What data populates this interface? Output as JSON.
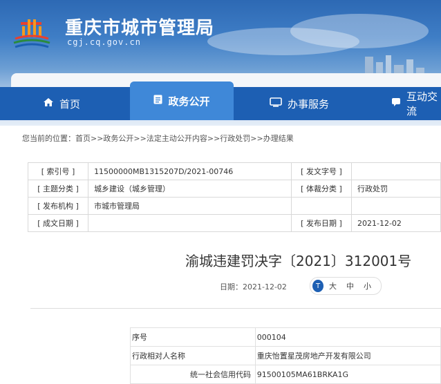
{
  "header": {
    "site_title": "重庆市城市管理局",
    "site_url": "cgj.cq.gov.cn",
    "logo": "chongqing-city-management-logo"
  },
  "nav": {
    "items": [
      {
        "label": "首页",
        "icon": "home-icon"
      },
      {
        "label": "政务公开",
        "icon": "document-icon",
        "active": true
      },
      {
        "label": "办事服务",
        "icon": "service-icon"
      },
      {
        "label": "互动交流",
        "icon": "chat-icon"
      }
    ]
  },
  "breadcrumb": {
    "prefix": "您当前的位置：",
    "path": "首页>>政务公开>>法定主动公开内容>>行政处罚>>办理结果"
  },
  "meta": {
    "index_label": "[ 索引号 ]",
    "index_value": "11500000MB1315207D/2021-00746",
    "doc_no_label": "[ 发文字号 ]",
    "doc_no_value": "",
    "topic_label": "[ 主题分类 ]",
    "topic_value": "城乡建设（城乡管理）",
    "genre_label": "[ 体裁分类 ]",
    "genre_value": "行政处罚",
    "org_label": "[ 发布机构 ]",
    "org_value": "市城市管理局",
    "created_label": "[ 成文日期 ]",
    "created_value": "",
    "published_label": "[ 发布日期 ]",
    "published_value": "2021-12-02"
  },
  "article": {
    "title": "渝城违建罚决字〔2021〕312001号",
    "date": "日期：2021-12-02",
    "font_icon_text": "T",
    "font_large": "大",
    "font_medium": "中",
    "font_small": "小"
  },
  "detail": {
    "rows": [
      {
        "key": "序号",
        "value": "000104"
      },
      {
        "key": "行政相对人名称",
        "value": "重庆怡置星茂房地产开发有限公司"
      },
      {
        "key": "统一社会信用代码",
        "value": "91500105MA61BRKA1G"
      }
    ]
  }
}
